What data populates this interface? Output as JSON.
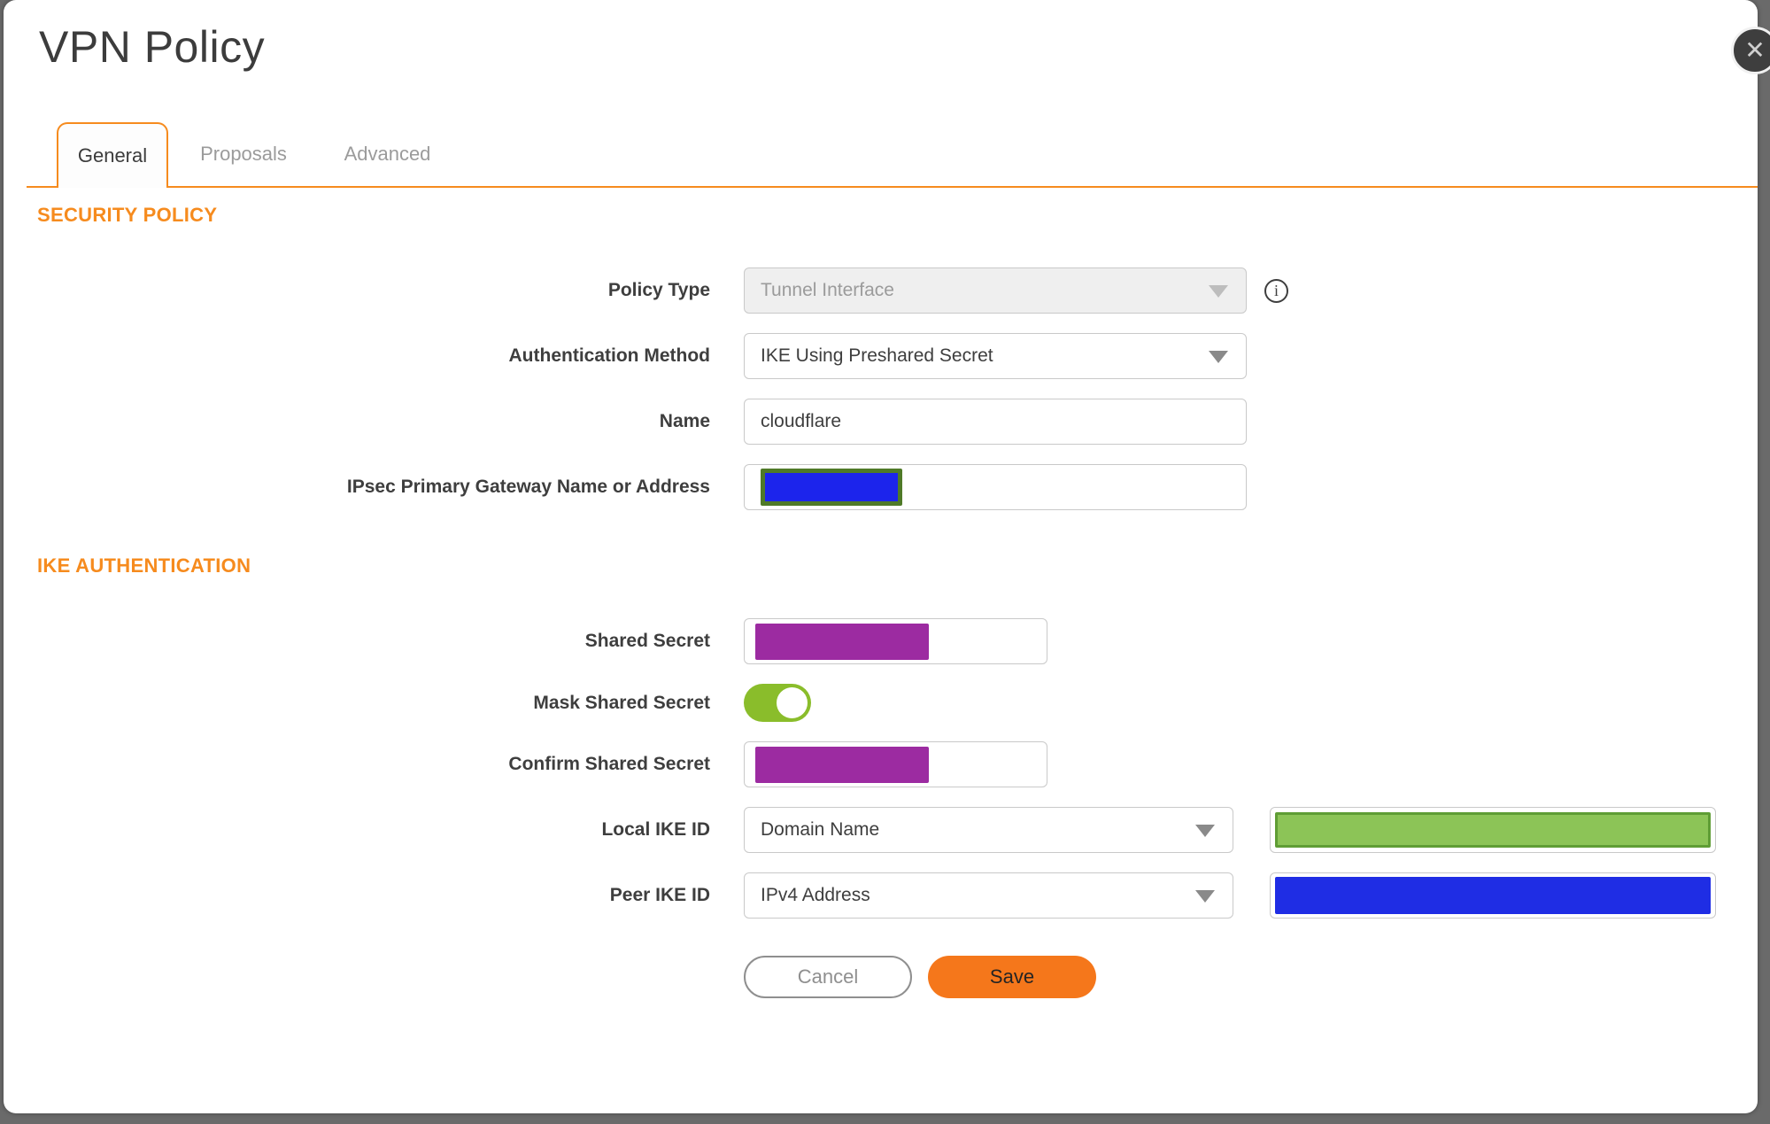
{
  "window": {
    "title": "VPN Policy",
    "close_icon": "✕"
  },
  "tabs": [
    {
      "label": "General",
      "active": true
    },
    {
      "label": "Proposals",
      "active": false
    },
    {
      "label": "Advanced",
      "active": false
    }
  ],
  "sections": {
    "security_policy": {
      "title": "SECURITY POLICY"
    },
    "ike_authentication": {
      "title": "IKE AUTHENTICATION"
    }
  },
  "fields": {
    "policy_type": {
      "label": "Policy Type",
      "value": "Tunnel Interface",
      "state": "disabled"
    },
    "auth_method": {
      "label": "Authentication Method",
      "value": "IKE Using Preshared Secret"
    },
    "name": {
      "label": "Name",
      "value": "cloudflare"
    },
    "gateway": {
      "label": "IPsec Primary Gateway Name or Address",
      "redacted": true
    },
    "shared_secret": {
      "label": "Shared Secret",
      "redacted": true
    },
    "mask_shared_secret": {
      "label": "Mask Shared Secret",
      "state": "on"
    },
    "confirm_shared_secret": {
      "label": "Confirm Shared Secret",
      "redacted": true
    },
    "local_ike_id": {
      "label": "Local IKE ID",
      "value": "Domain Name",
      "redacted_value": true
    },
    "peer_ike_id": {
      "label": "Peer IKE ID",
      "value": "IPv4 Address",
      "redacted_value": true
    }
  },
  "info_icon_glyph": "i",
  "buttons": {
    "cancel": "Cancel",
    "save": "Save"
  },
  "colors": {
    "accent_orange": "#F68B1E",
    "save_orange": "#F5771B",
    "toggle_green": "#8ABD2B",
    "redact_purple": "#9C2BA1",
    "redact_blue": "#1F2DE4",
    "redact_green_fill": "#8CC457",
    "redact_green_border": "#5F9D35",
    "redact_gateway_blue": "#1C24EC",
    "redact_gateway_border": "#4F7A28",
    "chrome_gray": "#6A6A6A"
  }
}
